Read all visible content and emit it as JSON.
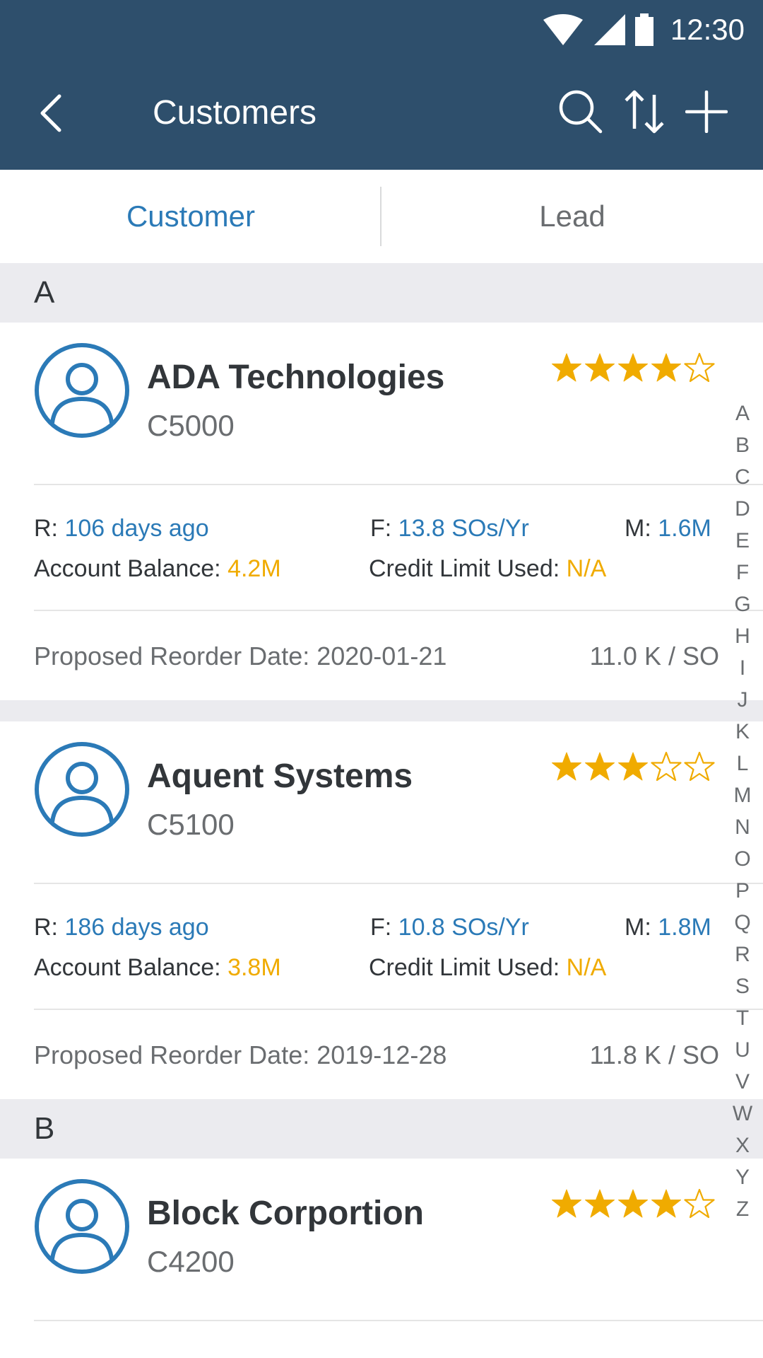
{
  "status_bar": {
    "time": "12:30",
    "icons": [
      "wifi-icon",
      "signal-icon",
      "battery-icon"
    ]
  },
  "app_bar": {
    "title": "Customers",
    "actions": [
      "search-icon",
      "sort-icon",
      "add-icon"
    ]
  },
  "tabs": [
    {
      "label": "Customer",
      "active": true
    },
    {
      "label": "Lead",
      "active": false
    }
  ],
  "sections": [
    {
      "letter": "A",
      "customers": [
        {
          "name": "ADA Technologies",
          "id": "C5000",
          "rating": 4,
          "r_label": "R: ",
          "r_value": "106 days ago",
          "f_label": "F: ",
          "f_value": "13.8 SOs/Yr",
          "m_label": "M: ",
          "m_value": "1.6M",
          "balance_label": "Account Balance: ",
          "balance_value": "4.2M",
          "credit_label": "Credit Limit Used: ",
          "credit_value": "N/A",
          "reorder": "Proposed Reorder Date: 2020-01-21",
          "per_so": "11.0 K / SO"
        },
        {
          "name": "Aquent Systems",
          "id": "C5100",
          "rating": 3,
          "r_label": "R: ",
          "r_value": "186 days ago",
          "f_label": "F: ",
          "f_value": "10.8 SOs/Yr",
          "m_label": "M: ",
          "m_value": "1.8M",
          "balance_label": "Account Balance: ",
          "balance_value": "3.8M",
          "credit_label": "Credit Limit Used: ",
          "credit_value": "N/A",
          "reorder": "Proposed Reorder Date: 2019-12-28",
          "per_so": "11.8 K / SO"
        }
      ]
    },
    {
      "letter": "B",
      "customers": [
        {
          "name": "Block Corportion",
          "id": "C4200",
          "rating": 4
        }
      ]
    }
  ],
  "index_letters": [
    "A",
    "B",
    "C",
    "D",
    "E",
    "F",
    "G",
    "H",
    "I",
    "J",
    "K",
    "L",
    "M",
    "N",
    "O",
    "P",
    "Q",
    "R",
    "S",
    "T",
    "U",
    "V",
    "W",
    "X",
    "Y",
    "Z"
  ],
  "colors": {
    "header": "#2e4f6c",
    "accent": "#2b7ab7",
    "highlight": "#f0ab00",
    "section_bg": "#ebebef"
  }
}
